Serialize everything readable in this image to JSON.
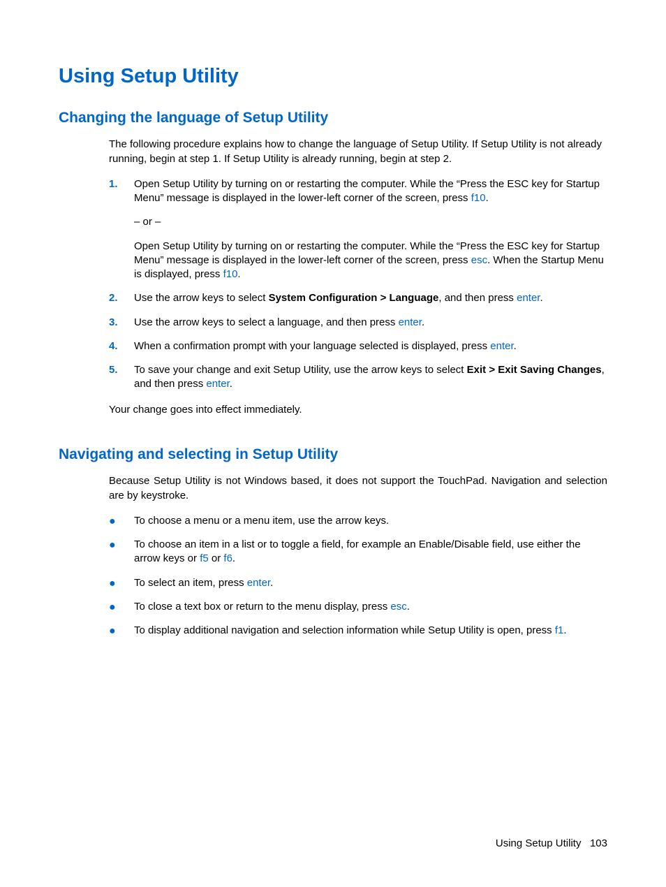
{
  "title": "Using Setup Utility",
  "sections": {
    "changing": {
      "heading": "Changing the language of Setup Utility",
      "intro": "The following procedure explains how to change the language of Setup Utility. If Setup Utility is not already running, begin at step 1. If Setup Utility is already running, begin at step 2.",
      "steps": [
        {
          "n": "1.",
          "pre1": "Open Setup Utility by turning on or restarting the computer. While the “Press the ESC key for Startup Menu” message is displayed in the lower-left corner of the screen, press ",
          "key1": "f10",
          "post1": ".",
          "or": "– or –",
          "pre2": "Open Setup Utility by turning on or restarting the computer. While the “Press the ESC key for Startup Menu” message is displayed in the lower-left corner of the screen, press ",
          "key2": "esc",
          "mid2": ". When the Startup Menu is displayed, press ",
          "key3": "f10",
          "post2": "."
        },
        {
          "n": "2.",
          "pre": "Use the arrow keys to select ",
          "bold": "System Configuration > Language",
          "mid": ", and then press ",
          "key": "enter",
          "post": "."
        },
        {
          "n": "3.",
          "pre": "Use the arrow keys to select a language, and then press ",
          "key": "enter",
          "post": "."
        },
        {
          "n": "4.",
          "pre": "When a confirmation prompt with your language selected is displayed, press ",
          "key": "enter",
          "post": "."
        },
        {
          "n": "5.",
          "pre": "To save your change and exit Setup Utility, use the arrow keys to select ",
          "bold": "Exit > Exit Saving Changes",
          "mid": ", and then press ",
          "key": "enter",
          "post": "."
        }
      ],
      "outro": "Your change goes into effect immediately."
    },
    "navigating": {
      "heading": "Navigating and selecting in Setup Utility",
      "intro": "Because Setup Utility is not Windows based, it does not support the TouchPad. Navigation and selection are by keystroke.",
      "bullets": [
        {
          "text": "To choose a menu or a menu item, use the arrow keys."
        },
        {
          "pre": "To choose an item in a list or to toggle a field, for example an Enable/Disable field, use either the arrow keys or ",
          "key1": "f5",
          "mid": " or ",
          "key2": "f6",
          "post": "."
        },
        {
          "pre": "To select an item, press ",
          "key": "enter",
          "post": "."
        },
        {
          "pre": "To close a text box or return to the menu display, press ",
          "key": "esc",
          "post": "."
        },
        {
          "pre": "To display additional navigation and selection information while Setup Utility is open, press ",
          "key": "f1",
          "post": "."
        }
      ]
    }
  },
  "footer": {
    "label": "Using Setup Utility",
    "page": "103"
  }
}
